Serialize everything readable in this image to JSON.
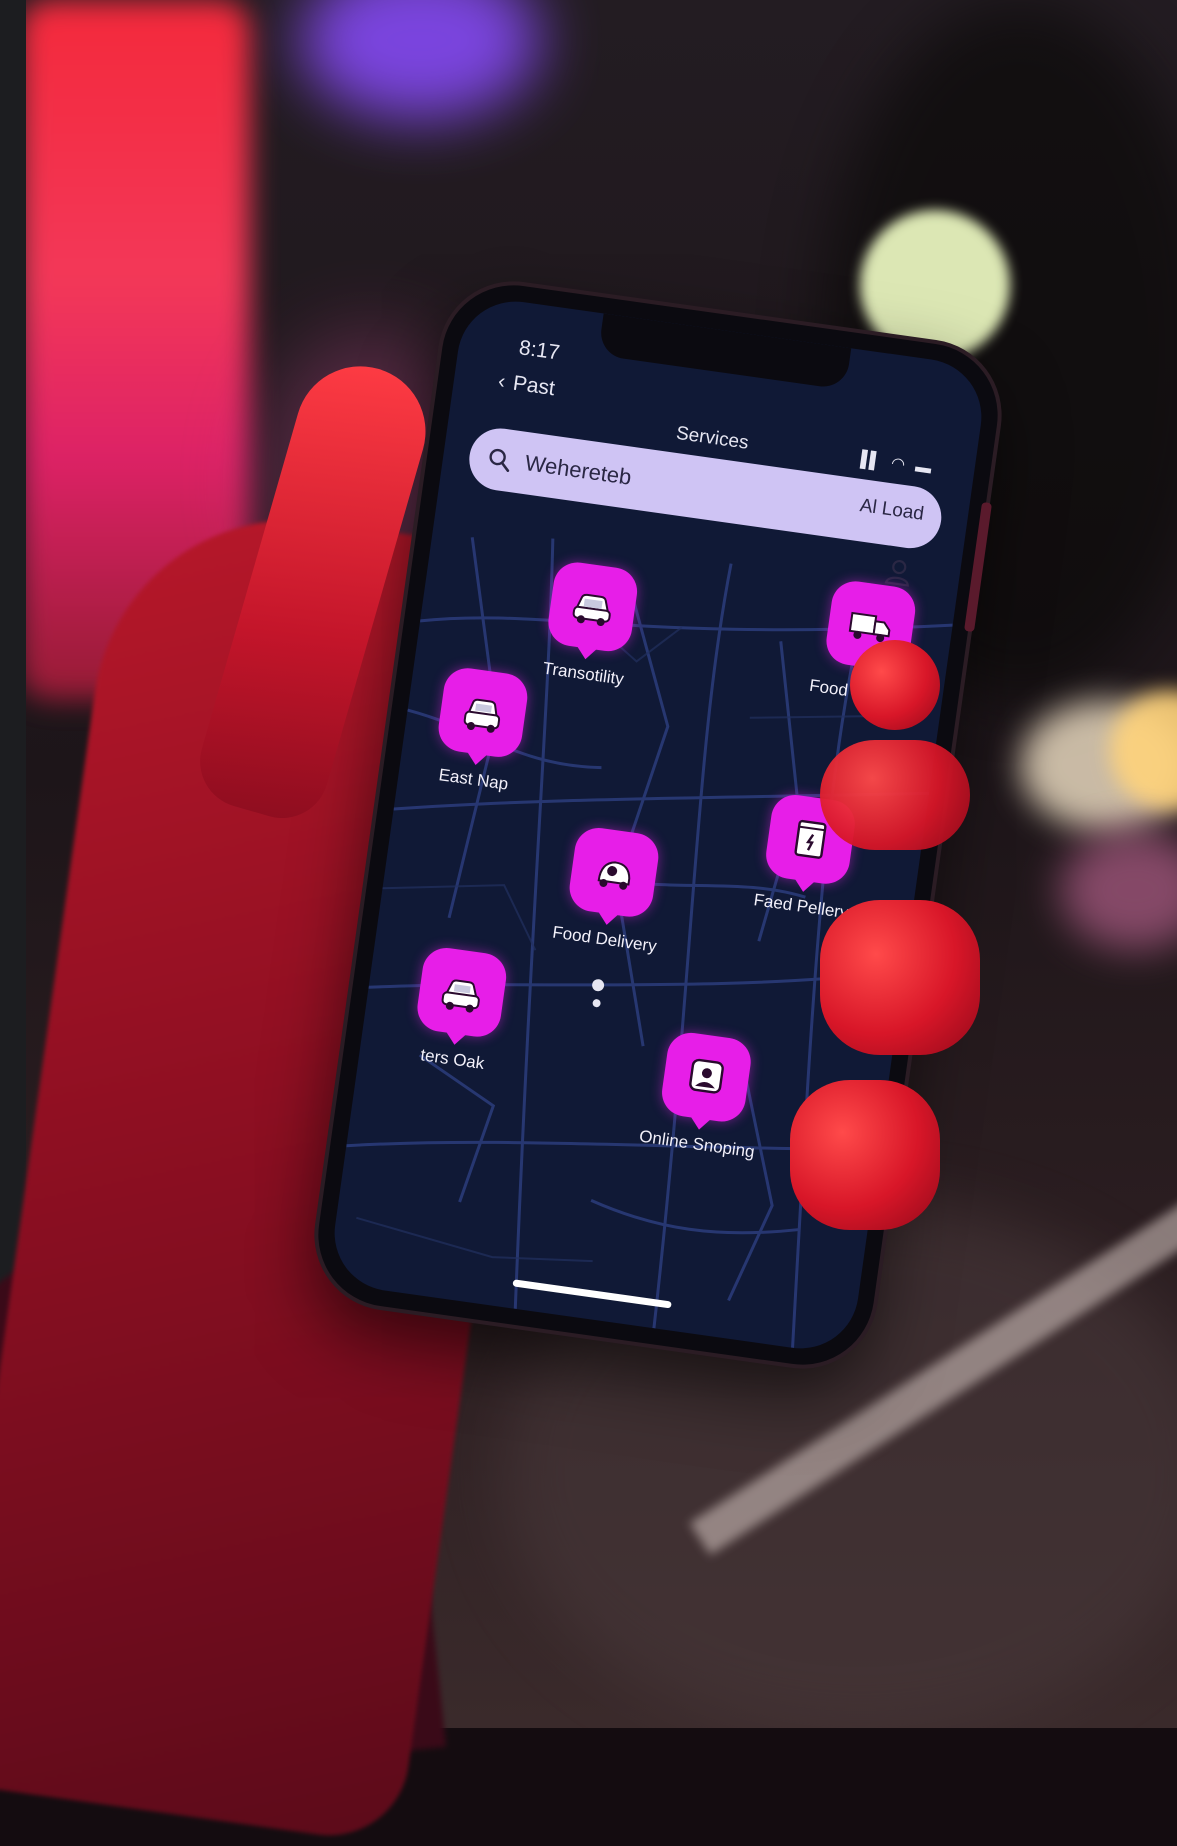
{
  "status_bar": {
    "time": "8:17",
    "icons": "▐▌ ◠ ▬"
  },
  "nav": {
    "back_label": "Past",
    "title": "Services"
  },
  "search": {
    "value": "Wehereteb",
    "right_label": "Al Load"
  },
  "pins": [
    {
      "label": "Transotility",
      "icon": "car-icon"
    },
    {
      "label": "Food Delivery",
      "icon": "truck-icon"
    },
    {
      "label": "East Nap",
      "icon": "car-icon"
    },
    {
      "label": "Faed Pellery",
      "icon": "door-icon"
    },
    {
      "label": "Food Delivery",
      "icon": "scooter-icon"
    },
    {
      "label": "ters Oak",
      "icon": "car-icon"
    },
    {
      "label": "Online Snoping",
      "icon": "person-icon"
    }
  ],
  "colors": {
    "accent": "#e71ee8",
    "map_bg": "#101936",
    "search_bg": "#cfc4f4"
  }
}
